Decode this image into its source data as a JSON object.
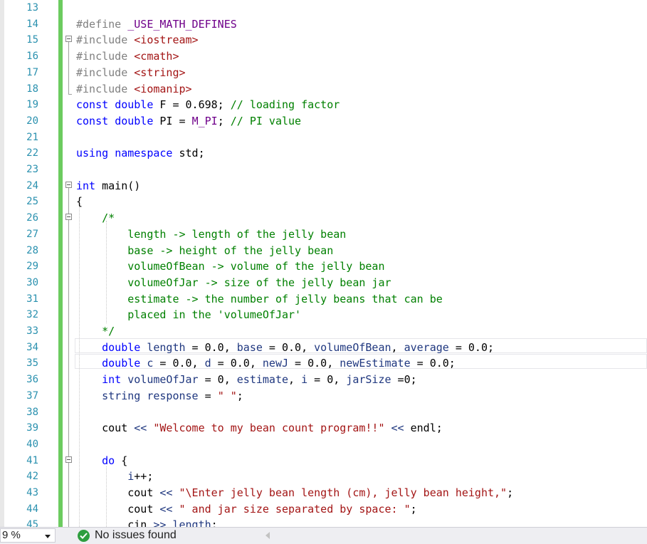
{
  "colors": {
    "keyword": "#0000ff",
    "string": "#a31515",
    "comment": "#008000",
    "preprocessor": "#808080",
    "include_path": "#a31515",
    "macro": "#6f008a",
    "identifier": "#1f377f",
    "line_number": "#2b91af",
    "change_bar": "#6ccb5f",
    "status_ok": "#2e9e3f"
  },
  "editor": {
    "lines": [
      {
        "num": "13",
        "tokens": []
      },
      {
        "num": "14",
        "tokens": [
          {
            "t": "#define ",
            "c": "preprocessor"
          },
          {
            "t": "_USE_MATH_DEFINES",
            "c": "macro"
          }
        ]
      },
      {
        "num": "15",
        "tokens": [
          {
            "t": "#include ",
            "c": "preprocessor"
          },
          {
            "t": "<iostream>",
            "c": "include_path"
          }
        ]
      },
      {
        "num": "16",
        "tokens": [
          {
            "t": "#include ",
            "c": "preprocessor"
          },
          {
            "t": "<cmath>",
            "c": "include_path"
          }
        ]
      },
      {
        "num": "17",
        "tokens": [
          {
            "t": "#include ",
            "c": "preprocessor"
          },
          {
            "t": "<string>",
            "c": "include_path"
          }
        ]
      },
      {
        "num": "18",
        "tokens": [
          {
            "t": "#include ",
            "c": "preprocessor"
          },
          {
            "t": "<iomanip>",
            "c": "include_path"
          }
        ]
      },
      {
        "num": "19",
        "tokens": [
          {
            "t": "const ",
            "c": "keyword"
          },
          {
            "t": "double ",
            "c": "keyword"
          },
          {
            "t": "F = 0.698; ",
            "c": "plain"
          },
          {
            "t": "// loading factor",
            "c": "comment"
          }
        ]
      },
      {
        "num": "20",
        "tokens": [
          {
            "t": "const ",
            "c": "keyword"
          },
          {
            "t": "double ",
            "c": "keyword"
          },
          {
            "t": "PI = ",
            "c": "plain"
          },
          {
            "t": "M_PI",
            "c": "macro"
          },
          {
            "t": "; ",
            "c": "plain"
          },
          {
            "t": "// PI value",
            "c": "comment"
          }
        ]
      },
      {
        "num": "21",
        "tokens": []
      },
      {
        "num": "22",
        "tokens": [
          {
            "t": "using ",
            "c": "keyword"
          },
          {
            "t": "namespace ",
            "c": "keyword"
          },
          {
            "t": "std;",
            "c": "plain"
          }
        ]
      },
      {
        "num": "23",
        "tokens": []
      },
      {
        "num": "24",
        "tokens": [
          {
            "t": "int ",
            "c": "keyword"
          },
          {
            "t": "main",
            "c": "plain"
          },
          {
            "t": "()",
            "c": "plain"
          }
        ]
      },
      {
        "num": "25",
        "tokens": [
          {
            "t": "{",
            "c": "plain"
          }
        ]
      },
      {
        "num": "26",
        "tokens": [
          {
            "t": "    /*",
            "c": "comment"
          }
        ]
      },
      {
        "num": "27",
        "tokens": [
          {
            "t": "        length -> length of the jelly bean",
            "c": "comment"
          }
        ]
      },
      {
        "num": "28",
        "tokens": [
          {
            "t": "        base -> height of the jelly bean",
            "c": "comment"
          }
        ]
      },
      {
        "num": "29",
        "tokens": [
          {
            "t": "        volumeOfBean -> volume of the jelly bean",
            "c": "comment"
          }
        ]
      },
      {
        "num": "30",
        "tokens": [
          {
            "t": "        volumeOfJar -> size of the jelly bean jar",
            "c": "comment"
          }
        ]
      },
      {
        "num": "31",
        "tokens": [
          {
            "t": "        estimate -> the number of jelly beans that can be",
            "c": "comment"
          }
        ]
      },
      {
        "num": "32",
        "tokens": [
          {
            "t": "        placed in the 'volumeOfJar'",
            "c": "comment"
          }
        ]
      },
      {
        "num": "33",
        "tokens": [
          {
            "t": "    */",
            "c": "comment"
          }
        ]
      },
      {
        "num": "34",
        "tokens": [
          {
            "t": "    ",
            "c": "plain"
          },
          {
            "t": "double ",
            "c": "keyword"
          },
          {
            "t": "length",
            "c": "identifier"
          },
          {
            "t": " = 0.0, ",
            "c": "plain"
          },
          {
            "t": "base",
            "c": "identifier"
          },
          {
            "t": " = 0.0, ",
            "c": "plain"
          },
          {
            "t": "volumeOfBean",
            "c": "identifier"
          },
          {
            "t": ", ",
            "c": "plain"
          },
          {
            "t": "average",
            "c": "identifier"
          },
          {
            "t": " = 0.0;",
            "c": "plain"
          }
        ]
      },
      {
        "num": "35",
        "tokens": [
          {
            "t": "    ",
            "c": "plain"
          },
          {
            "t": "double ",
            "c": "keyword"
          },
          {
            "t": "c",
            "c": "identifier"
          },
          {
            "t": " = 0.0, ",
            "c": "plain"
          },
          {
            "t": "d",
            "c": "identifier"
          },
          {
            "t": " = 0.0, ",
            "c": "plain"
          },
          {
            "t": "newJ",
            "c": "identifier"
          },
          {
            "t": " = 0.0, ",
            "c": "plain"
          },
          {
            "t": "newEstimate",
            "c": "identifier"
          },
          {
            "t": " = 0.0;",
            "c": "plain"
          }
        ]
      },
      {
        "num": "36",
        "tokens": [
          {
            "t": "    ",
            "c": "plain"
          },
          {
            "t": "int ",
            "c": "keyword"
          },
          {
            "t": "volumeOfJar",
            "c": "identifier"
          },
          {
            "t": " = 0, ",
            "c": "plain"
          },
          {
            "t": "estimate",
            "c": "identifier"
          },
          {
            "t": ", ",
            "c": "plain"
          },
          {
            "t": "i",
            "c": "identifier"
          },
          {
            "t": " = 0, ",
            "c": "plain"
          },
          {
            "t": "jarSize",
            "c": "identifier"
          },
          {
            "t": " =0;",
            "c": "plain"
          }
        ]
      },
      {
        "num": "37",
        "tokens": [
          {
            "t": "    ",
            "c": "plain"
          },
          {
            "t": "string ",
            "c": "identifier"
          },
          {
            "t": "response",
            "c": "identifier"
          },
          {
            "t": " = ",
            "c": "plain"
          },
          {
            "t": "\" \"",
            "c": "string"
          },
          {
            "t": ";",
            "c": "plain"
          }
        ]
      },
      {
        "num": "38",
        "tokens": []
      },
      {
        "num": "39",
        "tokens": [
          {
            "t": "    cout ",
            "c": "plain"
          },
          {
            "t": "<<",
            "c": "identifier"
          },
          {
            "t": " ",
            "c": "plain"
          },
          {
            "t": "\"Welcome to my bean count program!!\"",
            "c": "string"
          },
          {
            "t": " ",
            "c": "plain"
          },
          {
            "t": "<<",
            "c": "identifier"
          },
          {
            "t": " endl;",
            "c": "plain"
          }
        ]
      },
      {
        "num": "40",
        "tokens": []
      },
      {
        "num": "41",
        "tokens": [
          {
            "t": "    ",
            "c": "plain"
          },
          {
            "t": "do ",
            "c": "keyword"
          },
          {
            "t": "{",
            "c": "plain"
          }
        ]
      },
      {
        "num": "42",
        "tokens": [
          {
            "t": "        ",
            "c": "plain"
          },
          {
            "t": "i",
            "c": "identifier"
          },
          {
            "t": "++;",
            "c": "plain"
          }
        ]
      },
      {
        "num": "43",
        "tokens": [
          {
            "t": "        cout ",
            "c": "plain"
          },
          {
            "t": "<<",
            "c": "identifier"
          },
          {
            "t": " ",
            "c": "plain"
          },
          {
            "t": "\"\\Enter jelly bean length (cm), jelly bean height,\"",
            "c": "string"
          },
          {
            "t": ";",
            "c": "plain"
          }
        ]
      },
      {
        "num": "44",
        "tokens": [
          {
            "t": "        cout ",
            "c": "plain"
          },
          {
            "t": "<<",
            "c": "identifier"
          },
          {
            "t": " ",
            "c": "plain"
          },
          {
            "t": "\" and jar size separated by space: \"",
            "c": "string"
          },
          {
            "t": ";",
            "c": "plain"
          }
        ]
      },
      {
        "num": "45",
        "tokens": [
          {
            "t": "        cin ",
            "c": "plain"
          },
          {
            "t": ">>",
            "c": "identifier"
          },
          {
            "t": " ",
            "c": "plain"
          },
          {
            "t": "length",
            "c": "identifier"
          },
          {
            "t": ";",
            "c": "plain"
          }
        ]
      }
    ]
  },
  "status_bar": {
    "zoom": "9 %",
    "issues_text": "No issues found",
    "issues_icon": "check-circle-icon"
  }
}
